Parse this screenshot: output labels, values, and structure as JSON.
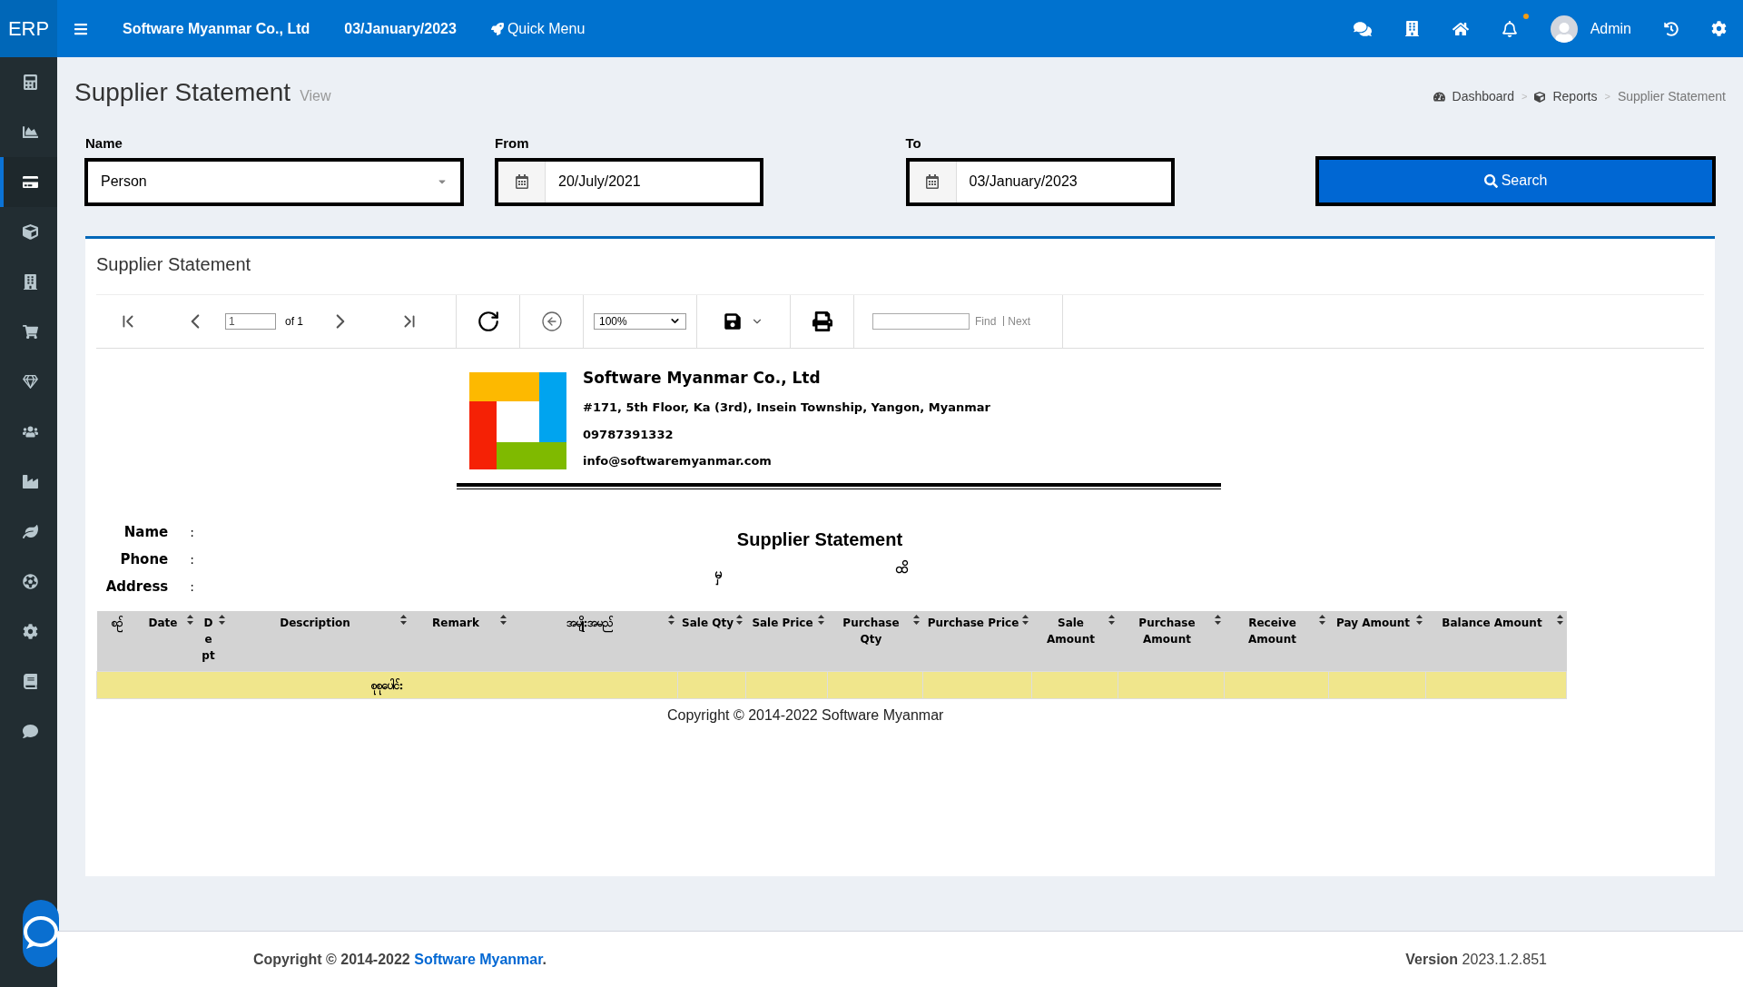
{
  "topbar": {
    "logo": "ERP",
    "company": "Software Myanmar Co., Ltd",
    "date": "03/January/2023",
    "quick_menu": "Quick Menu",
    "user": "Admin"
  },
  "sidebar": {
    "items": [
      {
        "selected": false
      },
      {
        "selected": false
      },
      {
        "selected": true
      },
      {
        "selected": false
      },
      {
        "selected": false
      },
      {
        "selected": false
      },
      {
        "selected": false
      },
      {
        "selected": false
      },
      {
        "selected": false
      },
      {
        "selected": false
      },
      {
        "selected": false
      },
      {
        "selected": false
      },
      {
        "selected": false
      },
      {
        "selected": false
      }
    ]
  },
  "page": {
    "title": "Supplier Statement",
    "subtitle": "View",
    "breadcrumbs": [
      "Dashboard",
      "Reports",
      "Supplier Statement"
    ],
    "breadcrumb_separator": ">"
  },
  "filters": {
    "name": {
      "label": "Name",
      "value": "Person"
    },
    "from": {
      "label": "From",
      "value": "20/July/2021"
    },
    "to": {
      "label": "To",
      "value": "03/January/2023"
    },
    "search": "Search"
  },
  "card": {
    "title": "Supplier Statement"
  },
  "toolbar": {
    "page": "1",
    "of": "of 1",
    "zoom": "100%",
    "find": "Find",
    "next": "Next"
  },
  "report": {
    "company": "Software Myanmar Co., Ltd",
    "address": "#171, 5th Floor, Ka (3rd), Insein Township, Yangon, Myanmar",
    "phone": "09787391332",
    "email": "info@softwaremyanmar.com",
    "fields": [
      {
        "label": "Name",
        "sep": ":"
      },
      {
        "label": "Phone",
        "sep": ":"
      },
      {
        "label": "Address",
        "sep": ":"
      }
    ],
    "title": "Supplier Statement",
    "from_mark": "မှ",
    "to_mark": "ထိ",
    "columns": [
      {
        "label": "စဉ်",
        "sortable": false
      },
      {
        "label": "Date",
        "sortable": true
      },
      {
        "label": "D e pt",
        "sortable": true
      },
      {
        "label": "Description",
        "sortable": true
      },
      {
        "label": "Remark",
        "sortable": true
      },
      {
        "label": "အမျိုးအမည်",
        "sortable": true
      },
      {
        "label": "Sale Qty",
        "sortable": true
      },
      {
        "label": "Sale Price",
        "sortable": true
      },
      {
        "label": "Purchase Qty",
        "sortable": true
      },
      {
        "label": "Purchase Price",
        "sortable": true
      },
      {
        "label": "Sale Amount",
        "sortable": true
      },
      {
        "label": "Purchase Amount",
        "sortable": true
      },
      {
        "label": "Receive Amount",
        "sortable": true
      },
      {
        "label": "Pay Amount",
        "sortable": true
      },
      {
        "label": "Balance Amount",
        "sortable": true
      }
    ],
    "total_label": "စုစုပေါင်း",
    "copyright": "Copyright © 2014-2022 Software Myanmar"
  },
  "footer": {
    "copyright": "Copyright © 2014-2022",
    "link": "Software Myanmar",
    "period": ".",
    "version_label": "Version",
    "version": "2023.1.2.851"
  }
}
